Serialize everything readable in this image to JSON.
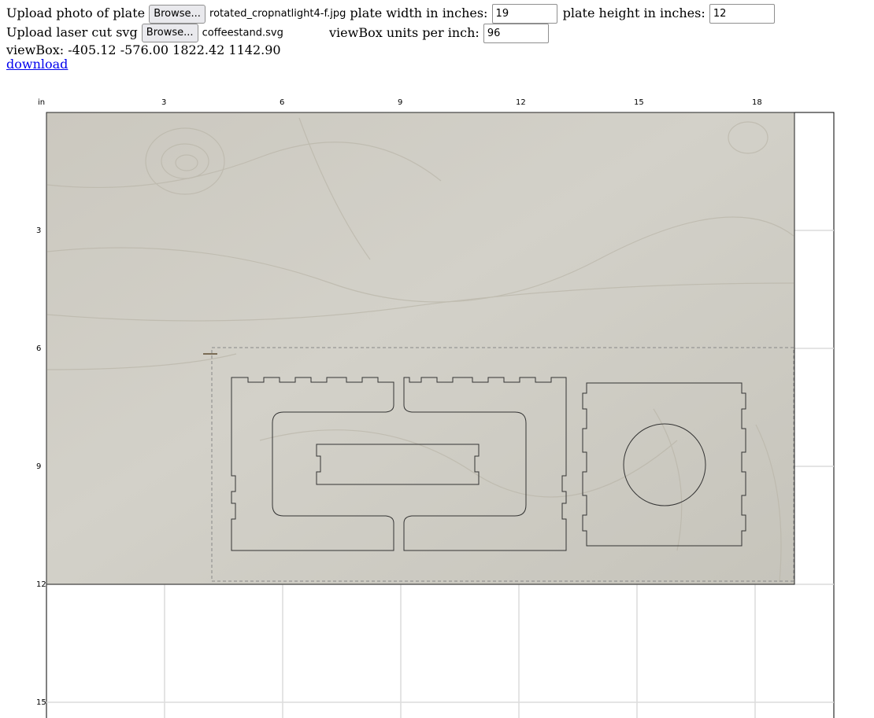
{
  "controls": {
    "photo_label": "Upload photo of plate",
    "photo_browse": "Browse...",
    "photo_filename": "rotated_cropnatlight4-f.jpg",
    "width_label": "plate width in inches:",
    "width_value": "19",
    "height_label": "plate height in inches:",
    "height_value": "12",
    "svg_label": "Upload laser cut svg",
    "svg_browse": "Browse...",
    "svg_filename": "coffeestand.svg",
    "units_label": "viewBox units per inch:",
    "units_value": "96",
    "viewbox_text": "viewBox: -405.12 -576.00 1822.42 1142.90",
    "download_label": "download"
  },
  "ruler": {
    "unit_label": "in",
    "x_ticks": [
      "3",
      "6",
      "9",
      "12",
      "15",
      "18"
    ],
    "y_ticks": [
      "3",
      "6",
      "9",
      "12",
      "15"
    ]
  },
  "colors": {
    "grid": "#dcdcdc",
    "plywood": "#c9c7be",
    "cut_line": "#333333",
    "bbox_dash": "#888888"
  }
}
